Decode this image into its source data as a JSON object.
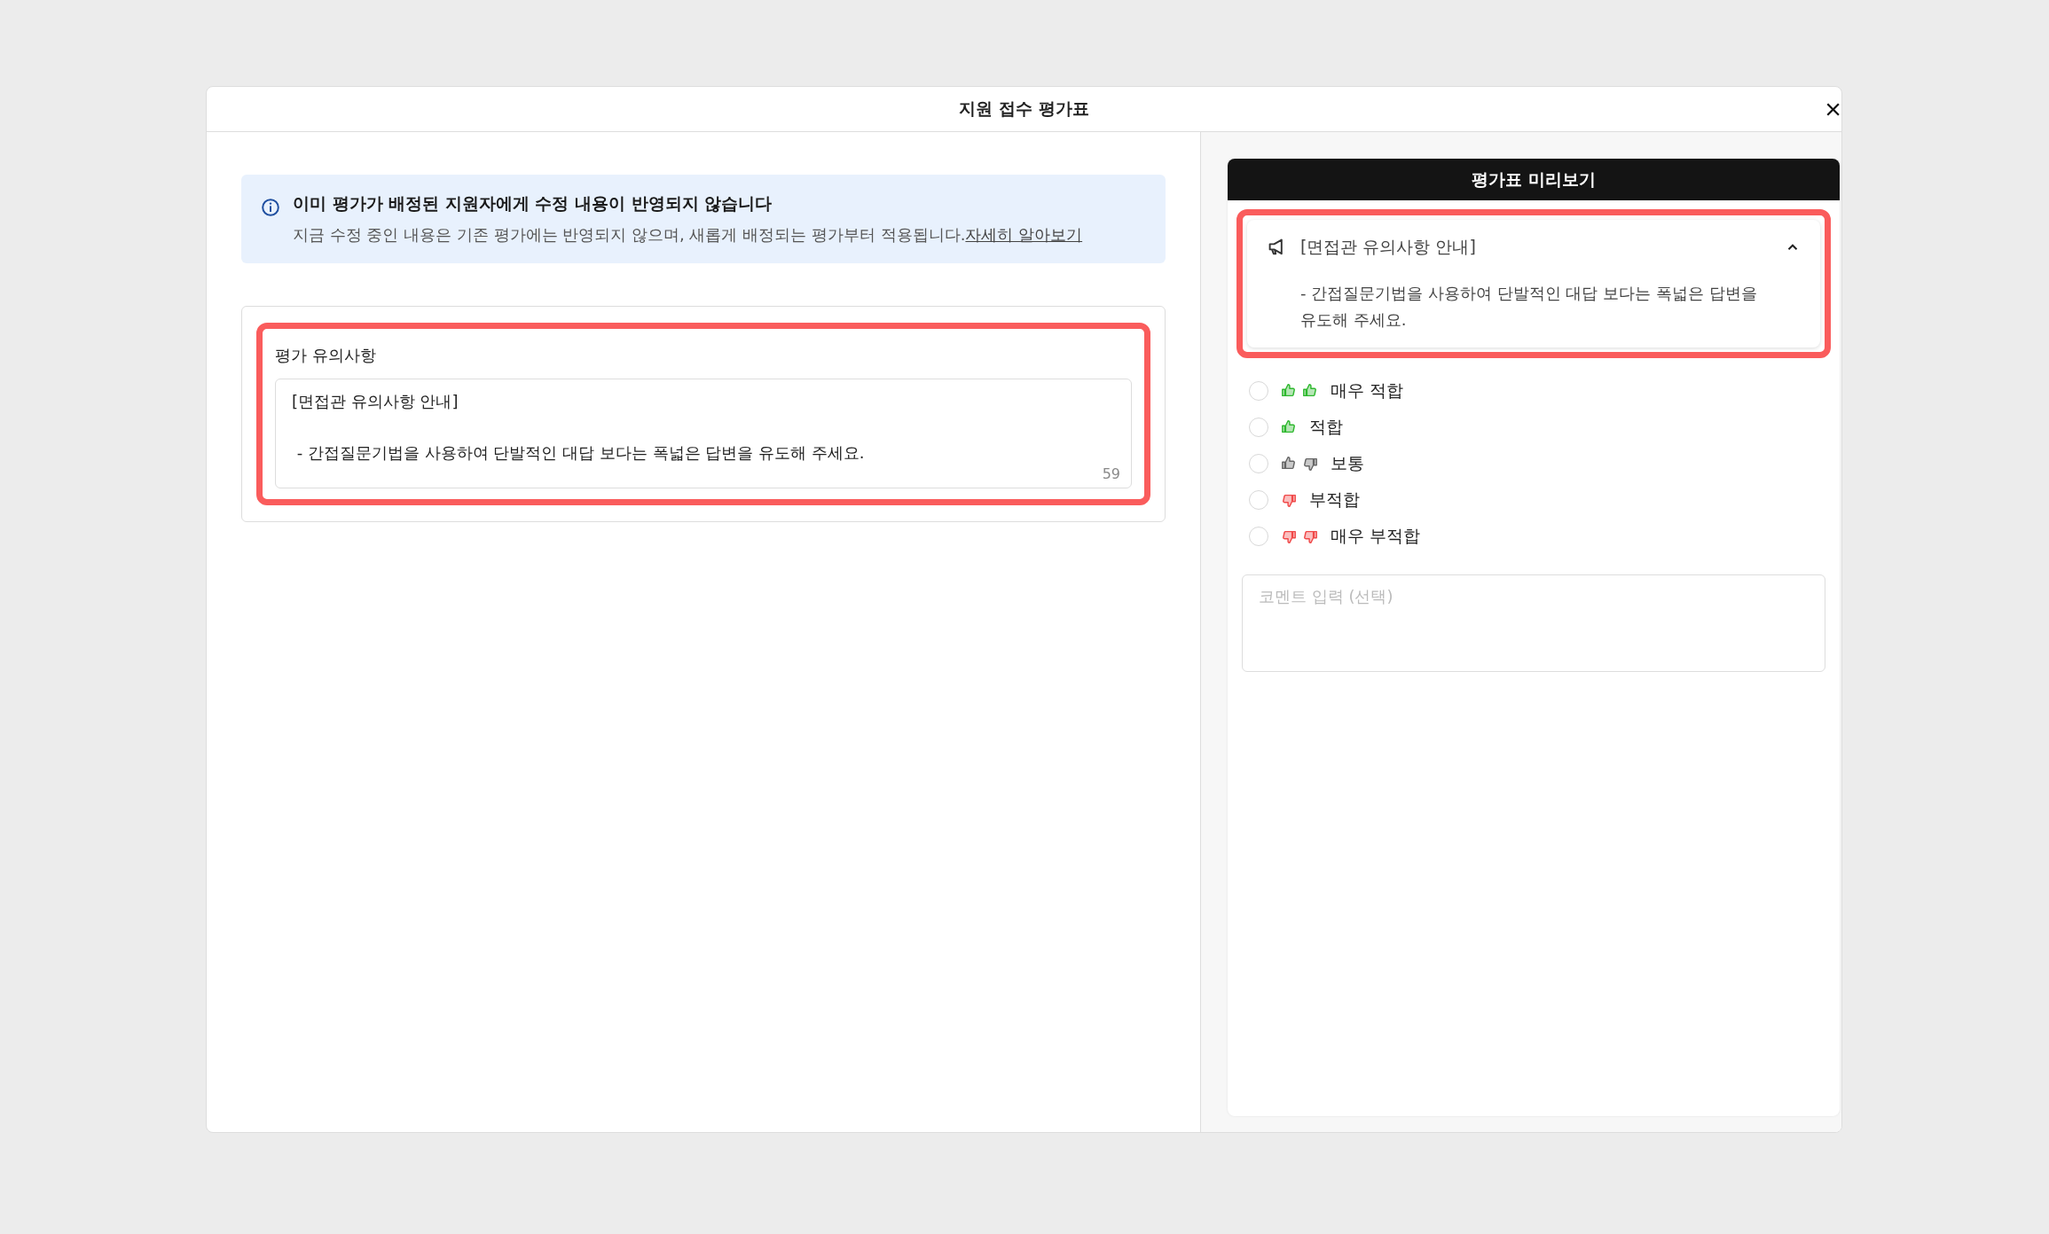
{
  "dialog": {
    "title": "지원 접수 평가표",
    "close": "×"
  },
  "notice": {
    "title": "이미 평가가 배정된 지원자에게 수정 내용이 반영되지 않습니다",
    "body": "지금 수정 중인 내용은 기존 평가에는 반영되지 않으며, 새롭게 배정되는 평가부터 적용됩니다.",
    "link": "자세히 알아보기"
  },
  "evaluation_notes": {
    "highlighted": true,
    "label": "평가 유의사항",
    "value": "[면접관 유의사항 안내]\n\n - 간접질문기법을 사용하여 단발적인 대답 보다는 폭넓은 답변을 유도해 주세요.",
    "count": "59"
  },
  "preview": {
    "title": "평가표 미리보기",
    "notice_card": {
      "highlighted": true,
      "expanded": true,
      "title": "[면접관 유의사항 안내]",
      "body": "- 간접질문기법을 사용하여 단발적인 대답 보다는 폭넓은 답변을 유도해 주세요."
    },
    "ratings": [
      {
        "label": "매우 적합",
        "selected": false,
        "thumbs": [
          {
            "kind": "up",
            "color": "#2eb82e"
          },
          {
            "kind": "up",
            "color": "#2eb82e"
          }
        ]
      },
      {
        "label": "적합",
        "selected": false,
        "thumbs": [
          {
            "kind": "up",
            "color": "#2eb82e"
          }
        ]
      },
      {
        "label": "보통",
        "selected": false,
        "thumbs": [
          {
            "kind": "up",
            "color": "#666666"
          },
          {
            "kind": "down",
            "color": "#666666"
          }
        ]
      },
      {
        "label": "부적합",
        "selected": false,
        "thumbs": [
          {
            "kind": "down",
            "color": "#f04848"
          }
        ]
      },
      {
        "label": "매우 부적합",
        "selected": false,
        "thumbs": [
          {
            "kind": "down",
            "color": "#f04848"
          },
          {
            "kind": "down",
            "color": "#f04848"
          }
        ]
      }
    ],
    "comment": {
      "placeholder": "코멘트 입력 (선택)"
    }
  }
}
